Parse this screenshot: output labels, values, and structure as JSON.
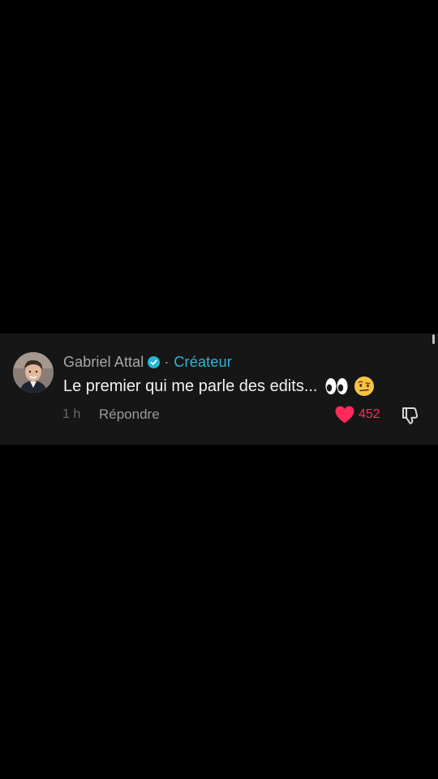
{
  "comment": {
    "author": "Gabriel Attal",
    "separator": "·",
    "creator_label": "Créateur",
    "text": "Le premier qui me parle des edits...",
    "emojis": [
      "eyes-emoji",
      "raised-eyebrow-face-emoji"
    ],
    "time": "1 h",
    "reply_label": "Répondre",
    "like_count": "452",
    "liked": true
  },
  "colors": {
    "background": "#000000",
    "card": "#161616",
    "creator_tag": "#2cb8d8",
    "like": "#ff2a5c",
    "verified": "#20b7d3"
  },
  "icons": {
    "verified": "verified-badge-icon",
    "like": "heart-icon",
    "dislike": "thumbs-down-icon"
  }
}
